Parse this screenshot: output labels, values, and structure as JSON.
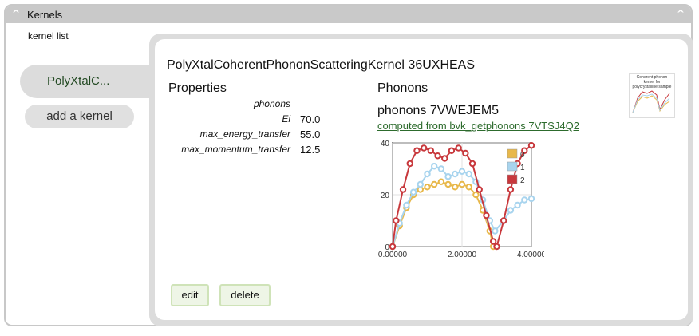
{
  "panel": {
    "title": "Kernels",
    "kernel_list_label": "kernel list"
  },
  "sidebar": {
    "active_kernel": "PolyXtalC...",
    "add_kernel": "add a kernel"
  },
  "kernel": {
    "title": "PolyXtalCoherentPhononScatteringKernel 36UXHEAS",
    "properties_heading": "Properties",
    "phonons_heading": "Phonons",
    "properties": [
      {
        "label": "phonons",
        "value": ""
      },
      {
        "label": "Ei",
        "value": "70.0"
      },
      {
        "label": "max_energy_transfer",
        "value": "55.0"
      },
      {
        "label": "max_momentum_transfer",
        "value": "12.5"
      }
    ],
    "phonons_name": "phonons 7VWEJEM5",
    "phonons_link": "computed from bvk_getphonons 7VTSJ4Q2",
    "thumbnail_caption": "Coherent phonon kernel for polycrystalline sample"
  },
  "buttons": {
    "edit": "edit",
    "delete": "delete"
  },
  "colors": {
    "series0": "#e8b84a",
    "series1": "#a8d4ee",
    "series2": "#c8383c",
    "link": "#2d6b2d"
  },
  "chart_data": {
    "type": "line",
    "ylim": [
      0,
      40
    ],
    "xlim": [
      0,
      4
    ],
    "yticks": [
      "0",
      "20",
      "40"
    ],
    "xticks": [
      "0.00000",
      "2.00000",
      "4.00000"
    ],
    "grid": true,
    "legend_position": "top-right",
    "series": [
      {
        "name": "0",
        "points": [
          [
            0,
            0
          ],
          [
            0.2,
            8
          ],
          [
            0.4,
            15
          ],
          [
            0.6,
            20
          ],
          [
            0.8,
            22
          ],
          [
            1.0,
            23
          ],
          [
            1.2,
            24
          ],
          [
            1.4,
            25
          ],
          [
            1.6,
            24
          ],
          [
            1.8,
            23
          ],
          [
            2.0,
            24
          ],
          [
            2.2,
            23
          ],
          [
            2.4,
            20
          ],
          [
            2.6,
            14
          ],
          [
            2.8,
            6
          ],
          [
            2.9,
            0
          ]
        ]
      },
      {
        "name": "1",
        "points": [
          [
            0,
            0
          ],
          [
            0.2,
            9
          ],
          [
            0.4,
            16
          ],
          [
            0.6,
            21
          ],
          [
            0.8,
            24
          ],
          [
            1.0,
            28
          ],
          [
            1.2,
            31
          ],
          [
            1.4,
            30
          ],
          [
            1.6,
            27
          ],
          [
            1.8,
            28
          ],
          [
            2.0,
            29
          ],
          [
            2.2,
            28
          ],
          [
            2.4,
            25
          ],
          [
            2.6,
            18
          ],
          [
            2.8,
            10
          ],
          [
            2.95,
            6
          ],
          [
            3.2,
            10
          ],
          [
            3.4,
            14
          ],
          [
            3.6,
            16
          ],
          [
            3.8,
            18
          ],
          [
            4.0,
            18.5
          ]
        ]
      },
      {
        "name": "2",
        "points": [
          [
            0,
            0
          ],
          [
            0.1,
            10
          ],
          [
            0.3,
            22
          ],
          [
            0.5,
            32
          ],
          [
            0.7,
            37
          ],
          [
            0.9,
            38
          ],
          [
            1.1,
            37
          ],
          [
            1.3,
            35
          ],
          [
            1.5,
            34
          ],
          [
            1.7,
            37
          ],
          [
            1.9,
            38
          ],
          [
            2.1,
            36
          ],
          [
            2.3,
            32
          ],
          [
            2.5,
            22
          ],
          [
            2.7,
            12
          ],
          [
            2.9,
            2
          ],
          [
            3.0,
            0
          ],
          [
            3.2,
            10
          ],
          [
            3.4,
            22
          ],
          [
            3.6,
            32
          ],
          [
            3.8,
            37
          ],
          [
            4.0,
            39
          ]
        ]
      }
    ]
  }
}
